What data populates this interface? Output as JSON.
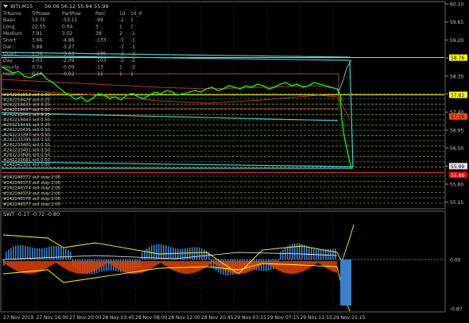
{
  "main_chart": {
    "title": "WTI,M15",
    "ohlc": "56.06 56.12 55.94 55.99",
    "y_ticks": [
      "60.10",
      "59.65",
      "59.20",
      "58.75",
      "58.30",
      "57.85",
      "57.40",
      "56.95",
      "56.50",
      "56.05",
      "55.60",
      "55.15"
    ],
    "price_tags": [
      {
        "text": "58.76",
        "bg": "#ffff00",
        "fg": "#000000"
      },
      {
        "text": "57.83",
        "bg": "#ffff00",
        "fg": "#000000"
      },
      {
        "text": "57.29",
        "bg": "#ff4d00",
        "fg": "#000000"
      },
      {
        "text": "55.99",
        "bg": "#e6e6e6",
        "fg": "#000000"
      },
      {
        "text": "55.89",
        "bg": "#ff0000",
        "fg": "#ffffff"
      }
    ]
  },
  "stats_table": {
    "headers": [
      "TrName",
      "TrPower",
      "PartPow",
      "Perc",
      "1d",
      "1d_0"
    ],
    "rows": [
      [
        "Basic",
        "53.75",
        "-53.11",
        "-99",
        "-2",
        "1"
      ],
      [
        "Long",
        "22.55",
        "0.64",
        "3",
        "1",
        "1"
      ],
      [
        "Medium",
        "7.91",
        "3.02",
        "38",
        "2",
        "-1"
      ],
      [
        "Short",
        "3.66",
        "-4.86",
        "-133",
        "-1",
        "-1"
      ],
      [
        "Dar...",
        "5.88",
        "-5.27",
        "-",
        "-1",
        "-1"
      ],
      [
        "Quart",
        "1.54",
        "-3.63",
        "-235",
        "-2",
        "-2"
      ],
      [
        "Day",
        "2.03",
        "-2.09",
        "-103",
        "-2",
        "-2"
      ],
      [
        "Hourly",
        "0.74",
        "-0.09",
        "-13",
        "1",
        "-2"
      ],
      [
        "Hour",
        "0.14",
        "-0.02",
        "-11",
        "1",
        "1"
      ]
    ]
  },
  "orders": [
    {
      "label": "#242201813 sell 1.00"
    },
    {
      "label": "#242218426 sell 0.25"
    },
    {
      "label": "#242218435 sell 0.25"
    },
    {
      "label": "#242218437 sell 0.50"
    },
    {
      "label": "#242218441 sell 0.25"
    },
    {
      "label": "#242218443 sell 0.50"
    },
    {
      "label": "#242218446 sell 0.25"
    },
    {
      "label": "#242220436 sell 0.50"
    },
    {
      "label": "#242233397 sell 0.50"
    },
    {
      "label": "#242233399 sell 0.50"
    },
    {
      "label": "#242233400 sell 0.50"
    },
    {
      "label": "#242233401 sell 0.50"
    },
    {
      "label": "#242233680 sell 0.50"
    },
    {
      "label": "#242233681 sell 0.50"
    },
    {
      "label": "#242241101 sell 1.00"
    }
  ],
  "stop_orders": [
    {
      "label": "#242246372 sell stop 2.00"
    },
    {
      "label": "#242246373 sell stop 2.00"
    },
    {
      "label": "#242246374 sell stop 2.00"
    },
    {
      "label": "#242246375 sell stop 2.00"
    },
    {
      "label": "#242246376 sell stop 2.00"
    },
    {
      "label": "#242246377 sell stop 2.00"
    }
  ],
  "indicator": {
    "title": "SWT -0.17 -0.72 -0.80",
    "y_ticks": [
      "0.00",
      "-0.87"
    ]
  },
  "x_axis": {
    "labels": [
      "27 Nov 2019",
      "27 Nov 16:00",
      "27 Nov 20:00",
      "28 Nov 03:45",
      "28 Nov 08:00",
      "28 Nov 12:00",
      "28 Nov 20:45",
      "29 Nov 03:15",
      "29 Nov 07:15",
      "29 Nov 11:15",
      "29 Nov 15:15"
    ]
  },
  "colors": {
    "background": "#000000",
    "grid": "#2a2a2a",
    "text": "#c8c8c8",
    "price_line": "#00ff00",
    "channel": "#40d0d0",
    "ma_red": "#c03030",
    "level_yellow": "#ffff00"
  }
}
